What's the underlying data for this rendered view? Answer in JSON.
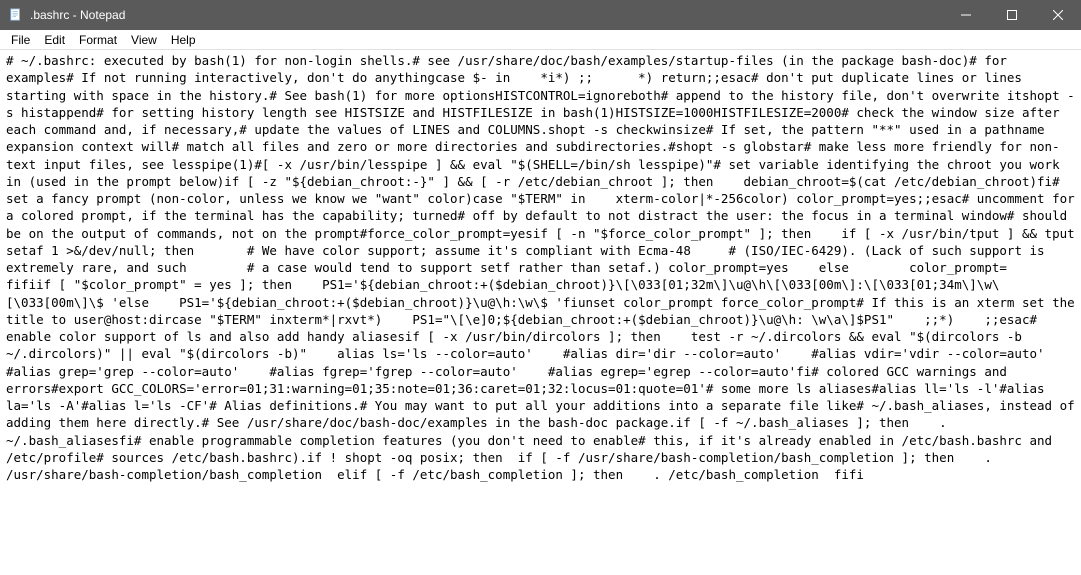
{
  "window": {
    "title": ".bashrc - Notepad"
  },
  "menu": {
    "file": "File",
    "edit": "Edit",
    "format": "Format",
    "view": "View",
    "help": "Help"
  },
  "content": {
    "text": "# ~/.bashrc: executed by bash(1) for non-login shells.# see /usr/share/doc/bash/examples/startup-files (in the package bash-doc)# for examples# If not running interactively, don't do anythingcase $- in    *i*) ;;      *) return;;esac# don't put duplicate lines or lines starting with space in the history.# See bash(1) for more optionsHISTCONTROL=ignoreboth# append to the history file, don't overwrite itshopt -s histappend# for setting history length see HISTSIZE and HISTFILESIZE in bash(1)HISTSIZE=1000HISTFILESIZE=2000# check the window size after each command and, if necessary,# update the values of LINES and COLUMNS.shopt -s checkwinsize# If set, the pattern \"**\" used in a pathname expansion context will# match all files and zero or more directories and subdirectories.#shopt -s globstar# make less more friendly for non-text input files, see lesspipe(1)#[ -x /usr/bin/lesspipe ] && eval \"$(SHELL=/bin/sh lesspipe)\"# set variable identifying the chroot you work in (used in the prompt below)if [ -z \"${debian_chroot:-}\" ] && [ -r /etc/debian_chroot ]; then    debian_chroot=$(cat /etc/debian_chroot)fi# set a fancy prompt (non-color, unless we know we \"want\" color)case \"$TERM\" in    xterm-color|*-256color) color_prompt=yes;;esac# uncomment for a colored prompt, if the terminal has the capability; turned# off by default to not distract the user: the focus in a terminal window# should be on the output of commands, not on the prompt#force_color_prompt=yesif [ -n \"$force_color_prompt\" ]; then    if [ -x /usr/bin/tput ] && tput setaf 1 >&/dev/null; then\t# We have color support; assume it's compliant with Ecma-48\t# (ISO/IEC-6429). (Lack of such support is\textremely rare, and such\t# a case would tend to support setf rather than setaf.)\tcolor_prompt=yes    else\tcolor_prompt=    fifiif [ \"$color_prompt\" = yes ]; then    PS1='${debian_chroot:+($debian_chroot)}\\[\\033[01;32m\\]\\u@\\h\\[\\033[00m\\]:\\[\\033[01;34m\\]\\w\\[\\033[00m\\]\\$ 'else    PS1='${debian_chroot:+($debian_chroot)}\\u@\\h:\\w\\$ 'fiunset color_prompt force_color_prompt# If this is an xterm set the title to user@host:dircase \"$TERM\" inxterm*|rxvt*)    PS1=\"\\[\\e]0;${debian_chroot:+($debian_chroot)}\\u@\\h: \\w\\a\\]$PS1\"    ;;*)    ;;esac# enable color support of ls and also add handy aliasesif [ -x /usr/bin/dircolors ]; then    test -r ~/.dircolors && eval \"$(dircolors -b ~/.dircolors)\" || eval \"$(dircolors -b)\"    alias ls='ls --color=auto'    #alias dir='dir --color=auto'    #alias vdir='vdir --color=auto'    #alias grep='grep --color=auto'    #alias fgrep='fgrep --color=auto'    #alias egrep='egrep --color=auto'fi# colored GCC warnings and errors#export GCC_COLORS='error=01;31:warning=01;35:note=01;36:caret=01;32:locus=01:quote=01'# some more ls aliases#alias ll='ls -l'#alias la='ls -A'#alias l='ls -CF'# Alias definitions.# You may want to put all your additions into a separate file like# ~/.bash_aliases, instead of adding them here directly.# See /usr/share/doc/bash-doc/examples in the bash-doc package.if [ -f ~/.bash_aliases ]; then    . ~/.bash_aliasesfi# enable programmable completion features (you don't need to enable# this, if it's already enabled in /etc/bash.bashrc and /etc/profile# sources /etc/bash.bashrc).if ! shopt -oq posix; then  if [ -f /usr/share/bash-completion/bash_completion ]; then    . /usr/share/bash-completion/bash_completion  elif [ -f /etc/bash_completion ]; then    . /etc/bash_completion  fifi"
  }
}
